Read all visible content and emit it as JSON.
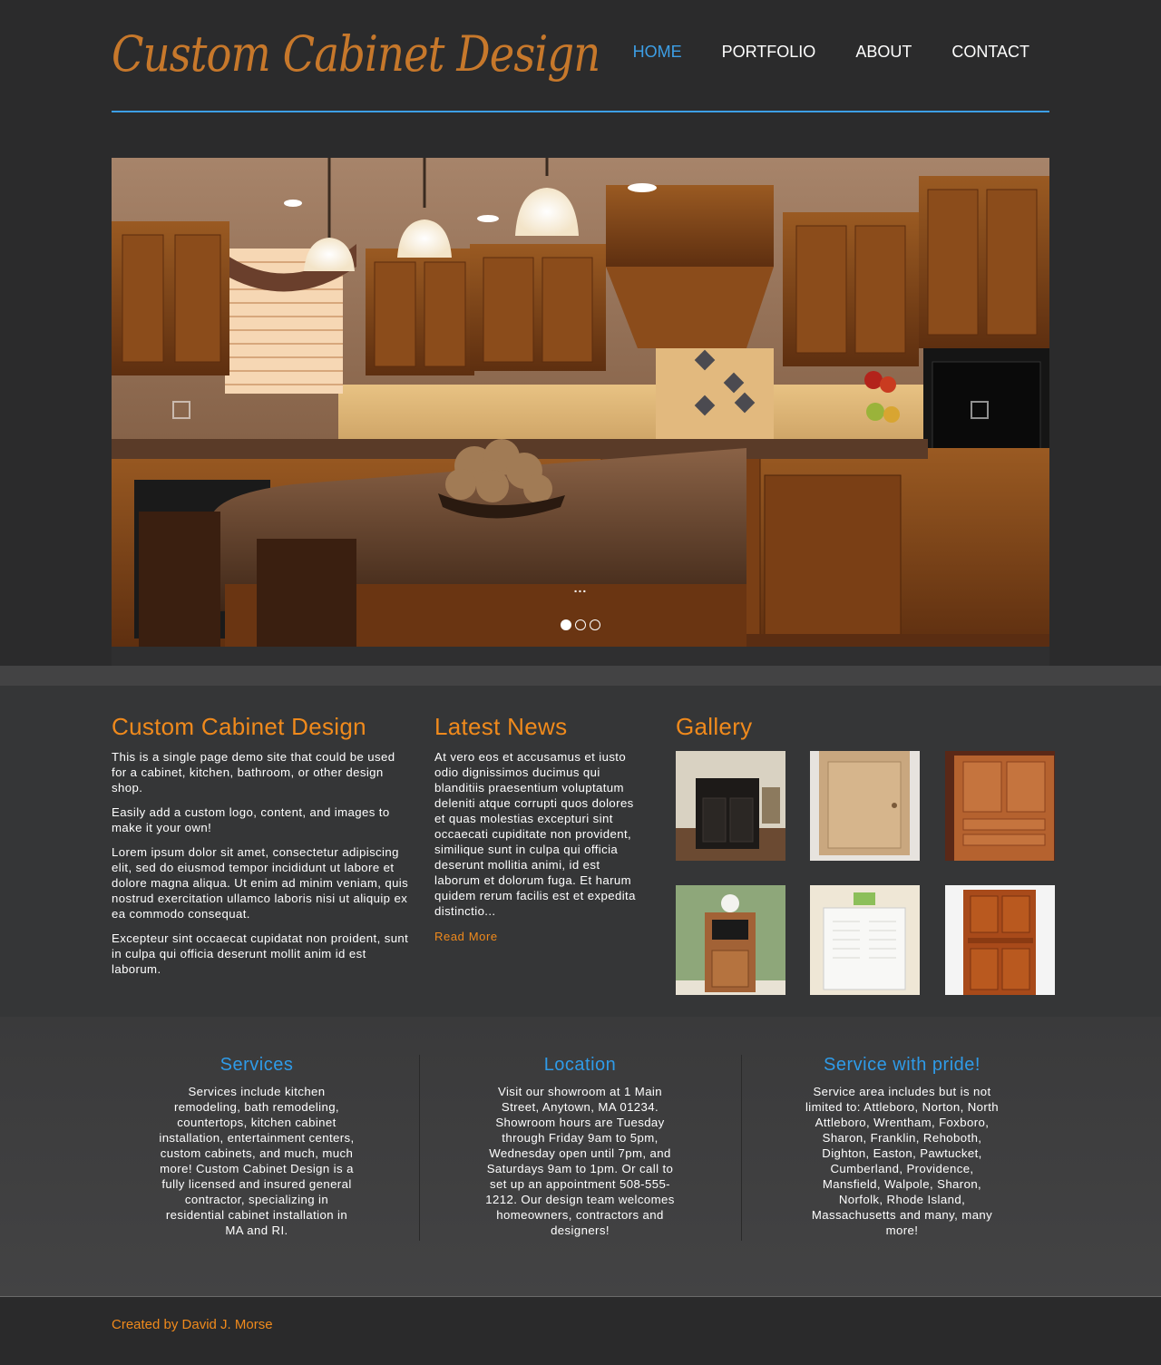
{
  "header": {
    "logo_text": "Custom Cabinet Design",
    "nav": [
      {
        "label": "HOME",
        "active": true
      },
      {
        "label": "PORTFOLIO",
        "active": false
      },
      {
        "label": "ABOUT",
        "active": false
      },
      {
        "label": "CONTACT",
        "active": false
      }
    ]
  },
  "slider": {
    "caption": "...",
    "slide_count": 3,
    "active_slide": 1,
    "prev_icon": "square-arrow-icon",
    "next_icon": "square-arrow-icon"
  },
  "about": {
    "title": "Custom Cabinet Design",
    "paragraphs": [
      "This is a single page demo site that could be used for a cabinet, kitchen, bathroom, or other design shop.",
      "Easily add a custom logo, content, and images to make it your own!",
      "Lorem ipsum dolor sit amet, consectetur adipiscing elit, sed do eiusmod tempor incididunt ut labore et dolore magna aliqua. Ut enim ad minim veniam, quis nostrud exercitation ullamco laboris nisi ut aliquip ex ea commodo consequat.",
      "Excepteur sint occaecat cupidatat non proident, sunt in culpa qui officia deserunt mollit anim id est laborum."
    ]
  },
  "news": {
    "title": "Latest News",
    "text": "At vero eos et accusamus et iusto odio dignissimos ducimus qui blanditiis praesentium voluptatum deleniti atque corrupti quos dolores et quas molestias excepturi sint occaecati cupiditate non provident, similique sunt in culpa qui officia deserunt mollitia animi, id est laborum et dolorum fuga. Et harum quidem rerum facilis est et expedita distinctio...",
    "read_more": "Read More"
  },
  "gallery": {
    "title": "Gallery"
  },
  "info": {
    "services": {
      "title": "Services",
      "text": "Services include kitchen remodeling, bath remodeling, countertops, kitchen cabinet installation, entertainment centers, custom cabinets, and much, much more! Custom Cabinet Design is a fully licensed and insured general contractor, specializing in residential cabinet installation in MA and RI."
    },
    "location": {
      "title": "Location",
      "text": "Visit our showroom at 1 Main Street, Anytown, MA 01234. Showroom hours are Tuesday through Friday 9am to 5pm, Wednesday open until 7pm, and Saturdays 9am to 1pm. Or call to set up an appointment 508-555-1212. Our design team welcomes homeowners, contractors and designers!"
    },
    "pride": {
      "title": "Service with pride!",
      "text": "Service area includes but is not limited to: Attleboro, Norton, North Attleboro, Wrentham, Foxboro, Sharon, Franklin, Rehoboth, Dighton, Easton, Pawtucket, Cumberland, Providence, Mansfield, Walpole, Sharon, Norfolk, Rhode Island, Massachusetts and many, many more!"
    }
  },
  "footer": {
    "credit": "Created by David J. Morse"
  },
  "colors": {
    "accent_orange": "#f08a1c",
    "accent_blue": "#2f9be8",
    "logo": "#c7782b"
  }
}
